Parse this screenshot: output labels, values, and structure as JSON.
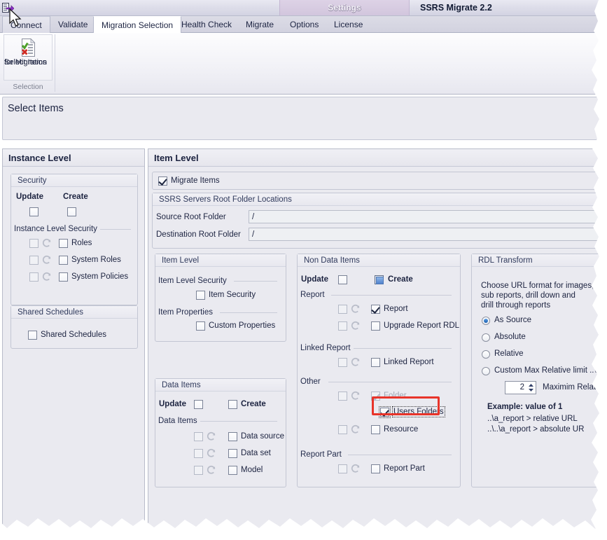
{
  "titlebar": {
    "app_icon": "migrate-arrow-icon",
    "settings_group_label": "Settings",
    "app_title": "SSRS Migrate 2.2"
  },
  "tabs": [
    {
      "label": "Connect",
      "active": false
    },
    {
      "label": "Validate",
      "active": false
    },
    {
      "label": "Migration Selection",
      "active": true
    },
    {
      "label": "Health Check",
      "active": false
    },
    {
      "label": "Migrate",
      "active": false
    },
    {
      "label": "Options",
      "active": false
    },
    {
      "label": "License",
      "active": false
    }
  ],
  "ribbon": {
    "button_label_line1": "Select Items",
    "button_label_line2": "for Migration",
    "button_icon": "document-check-x-icon",
    "group_name": "Selection"
  },
  "page_header": {
    "title": "Select Items"
  },
  "instance_level": {
    "title": "Instance Level",
    "security": {
      "box_label": "Security",
      "update_label": "Update",
      "create_label": "Create",
      "update_checked": false,
      "create_checked": false,
      "section_label": "Instance Level Security",
      "rows": [
        {
          "label": "Roles",
          "update_checked": false,
          "create_checked": false
        },
        {
          "label": "System Roles",
          "update_checked": false,
          "create_checked": false
        },
        {
          "label": "System Policies",
          "update_checked": false,
          "create_checked": false
        }
      ]
    },
    "shared_schedules": {
      "box_label": "Shared Schedules",
      "checkbox_label": "Shared Schedules",
      "checked": false
    }
  },
  "item_level_panel": {
    "title": "Item Level",
    "migrate_items_label": "Migrate Items",
    "migrate_items_checked": true,
    "root_folders": {
      "box_label": "SSRS Servers Root Folder Locations",
      "source_label": "Source Root Folder",
      "source_value": "/",
      "destination_label": "Destination Root Folder",
      "destination_value": "/"
    },
    "item_level_box": {
      "box_label": "Item Level",
      "security_section": "Item Level Security",
      "item_security_label": "Item Security",
      "item_security_checked": false,
      "properties_section": "Item Properties",
      "custom_properties_label": "Custom Properties",
      "custom_properties_checked": false
    },
    "data_items_box": {
      "box_label": "Data Items",
      "update_label": "Update",
      "create_label": "Create",
      "update_checked": false,
      "create_checked": false,
      "section_label": "Data Items",
      "rows": [
        {
          "label": "Data source",
          "update_checked": false,
          "create_checked": false
        },
        {
          "label": "Data set",
          "update_checked": false,
          "create_checked": false
        },
        {
          "label": "Model",
          "update_checked": false,
          "create_checked": false
        }
      ]
    },
    "non_data_items_box": {
      "box_label": "Non Data Items",
      "update_label": "Update",
      "create_label": "Create",
      "update_checked": false,
      "create_state": "indeterminate",
      "sections": [
        {
          "label": "Report",
          "rows": [
            {
              "label": "Report",
              "update_checked": false,
              "create_checked": true,
              "disabled": false,
              "focused": false
            },
            {
              "label": "Upgrade Report RDL",
              "update_checked": false,
              "create_checked": false,
              "disabled": false,
              "focused": false
            }
          ]
        },
        {
          "label": "Linked Report",
          "rows": [
            {
              "label": "Linked Report",
              "update_checked": false,
              "create_checked": false,
              "disabled": false,
              "focused": false
            }
          ]
        },
        {
          "label": "Other",
          "rows": [
            {
              "label": "Folder",
              "update_checked": false,
              "create_checked": true,
              "disabled": true,
              "focused": false
            },
            {
              "label": "Users Folders",
              "update_checked": null,
              "create_checked": true,
              "disabled": false,
              "focused": true
            },
            {
              "label": "Resource",
              "update_checked": false,
              "create_checked": false,
              "disabled": false,
              "focused": false
            }
          ]
        },
        {
          "label": "Report Part",
          "rows": [
            {
              "label": "Report Part",
              "update_checked": false,
              "create_checked": false,
              "disabled": false,
              "focused": false
            }
          ]
        }
      ]
    },
    "rdl_transform_box": {
      "box_label": "RDL Transform",
      "description_line1": "Choose URL format for images,",
      "description_line2": "sub reports, drill down and",
      "description_line3": "drill through reports",
      "options": [
        {
          "label": "As Source",
          "selected": true
        },
        {
          "label": "Absolute",
          "selected": false
        },
        {
          "label": "Relative",
          "selected": false
        },
        {
          "label": "Custom  Max Relative limit ..\\",
          "selected": false
        }
      ],
      "spinner_value": "2",
      "spinner_label": "Maximim Relative Li",
      "example_title": "Example: value of 1",
      "example_line1": "..\\a_report > relative URL",
      "example_line2": "..\\..\\a_report > absolute UR"
    }
  },
  "annotation": {
    "target": "Users Folders",
    "color": "#e8342a"
  },
  "cursor": {
    "name": "mouse-pointer"
  }
}
